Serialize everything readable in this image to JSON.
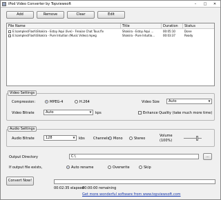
{
  "window": {
    "title": "iPod Video Converter by Topviewsoft"
  },
  "toolbar": {
    "add": "Add",
    "remove": "Remove",
    "clear": "Clear",
    "edit": "Edit"
  },
  "files": {
    "headers": [
      "File Name",
      "Title",
      "Duration",
      "Status"
    ],
    "rows": [
      {
        "name": "E:\\samples\\Flash\\Shakira - Estoy Aqui (live) - Freaian Chat Tous.flv",
        "title": "Shakira - Estoy Aqui ...",
        "duration": "00:05:10",
        "status": "Done"
      },
      {
        "name": "E:\\samples\\Flash\\Shakira - Pure Intuition (Music Video).mpeg",
        "title": "Shakira - Pure Intuitio...",
        "duration": "00:03:37",
        "status": "Ready"
      }
    ]
  },
  "video": {
    "group_label": "Video Settings",
    "compression_label": "Compression:",
    "mpeg4": "MPEG-4",
    "h264": "H.264",
    "compression_selected": "MPEG-4",
    "size_label": "Video Size",
    "size_value": "Auto",
    "bitrate_label": "Video Bitrate",
    "bitrate_value": "Auto",
    "bitrate_unit": "kps",
    "enhance_label": "Enhance Quality (take much more time)"
  },
  "audio": {
    "group_label": "Audio Settings",
    "bitrate_label": "Audio Bitrate",
    "bitrate_value": "128",
    "bitrate_unit": "kbs",
    "channels_label": "Channels",
    "mono": "Mono",
    "stereo": "Stereo",
    "channel_selected": "Mono",
    "volume_label": "Volume",
    "volume_value": "(100%)",
    "volume_level": 1.0
  },
  "output": {
    "dir_label": "Output Directory",
    "dir_value": "C:\\",
    "browse": "...",
    "exists_label": "If output file exists,",
    "opt_autorename": "Auto rename",
    "opt_overwrite": "Overwrite",
    "opt_skip": "Skip",
    "exists_selected": "Auto rename"
  },
  "status": {
    "convert_button": "Convert Now!",
    "elapsed": "00:02:35 elapsed",
    "remaining": "00:00:00 remaining",
    "progress": 0,
    "link": "Get more wonderful software from www.topviewsoft.com"
  }
}
